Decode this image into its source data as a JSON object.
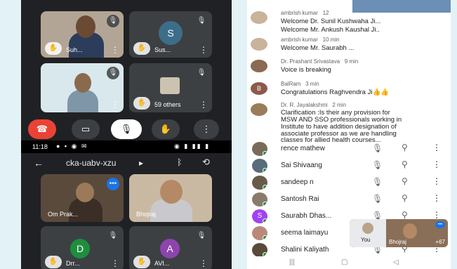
{
  "colors": {
    "meet_bg": "#202124",
    "end_call": "#ea4335",
    "page_bg": "#e3f2f6",
    "online": "#1e8e3e"
  },
  "meet_top": {
    "tiles": [
      {
        "name": "Suh...",
        "type": "video"
      },
      {
        "name": "Sus...",
        "type": "avatar",
        "initial": "S",
        "avatar_color": "#3c6e89"
      },
      {
        "name": "",
        "type": "video"
      },
      {
        "name": "59 others",
        "type": "group"
      }
    ],
    "controls": [
      "end-call",
      "camera",
      "microphone",
      "raise-hand",
      "more"
    ]
  },
  "statusbar": {
    "time": "11:18"
  },
  "meet_header": {
    "meeting_code": "cka-uabv-xzu",
    "code_arrow": "▸"
  },
  "meet_bottom": {
    "tiles": [
      {
        "name": "Om Prak...",
        "type": "video"
      },
      {
        "name": "Bhojraj",
        "type": "video"
      },
      {
        "name": "Drr...",
        "type": "avatar",
        "initial": "D",
        "avatar_color": "#1e8e3e"
      },
      {
        "name": "AVI...",
        "type": "avatar",
        "initial": "A",
        "avatar_color": "#8e44ad"
      }
    ]
  },
  "chat": {
    "messages": [
      {
        "sender": "ambrish kumar",
        "time": "12",
        "lines": [
          "Welcome Dr. Sunil Kushwaha Ji...",
          "Welcome Mr. Ankush Kaushal Ji.."
        ]
      },
      {
        "sender": "ambrish kumar",
        "time": "10 min",
        "lines": [
          "Welcome Mr. Saurabh ..."
        ]
      },
      {
        "sender": "Dr. Prashant Srivastava",
        "time": "9 min",
        "lines": [
          "Voice is breaking"
        ]
      },
      {
        "sender": "BalRam",
        "time": "3 min",
        "avatar_initial": "B",
        "lines": [
          "Congratulations Raghvendra Ji👍👍"
        ]
      },
      {
        "sender": "Dr. R. Jayalakshmi",
        "time": "2 min",
        "lines": [
          "Clarification :Is their any  provision for",
          "MSW AND SSO  professionals working in",
          "Institute to have addition designation of",
          "associate professor as we are handling",
          "classes for allied health courses..."
        ]
      }
    ]
  },
  "participants": [
    {
      "name": "rence mathew",
      "avatar": "photo"
    },
    {
      "name": "Sai Shivaang",
      "avatar": "photo"
    },
    {
      "name": "sandeep n",
      "avatar": "photo"
    },
    {
      "name": "Santosh Rai",
      "avatar": "photo"
    },
    {
      "name": "Saurabh Dhas...",
      "avatar": "letter",
      "initial": "S"
    },
    {
      "name": "seema laimayu",
      "avatar": "photo"
    },
    {
      "name": "Shalini Kaliyath",
      "avatar": "photo"
    }
  ],
  "pip": {
    "self_label": "You",
    "other_label": "Bhojraj",
    "count": "+67"
  }
}
